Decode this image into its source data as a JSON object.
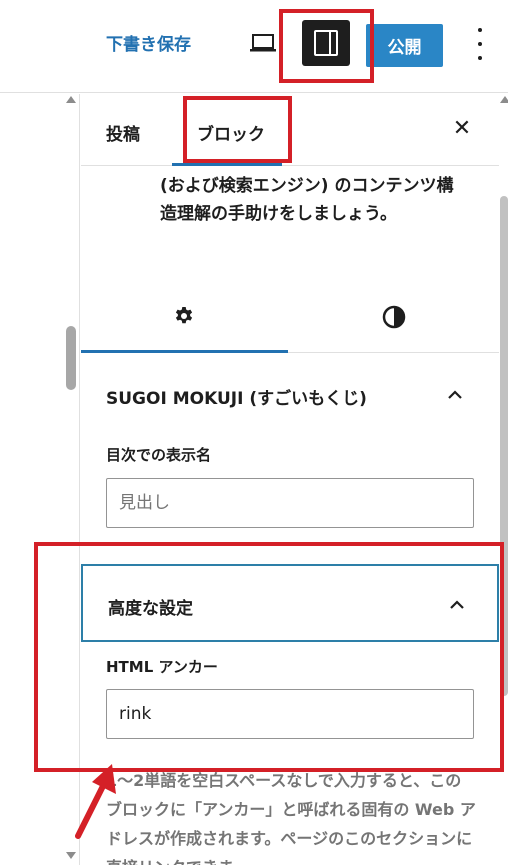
{
  "toolbar": {
    "save_draft_label": "下書き保存",
    "preview_icon": "desktop-preview-icon",
    "sidebar_toggle_icon": "sidebar-toggle-icon",
    "publish_label": "公開",
    "more_icon": "vertical-ellipsis-icon"
  },
  "sidebar": {
    "tab_post_label": "投稿",
    "tab_block_label": "ブロック",
    "close_icon_glyph": "✕",
    "block_description": "(および検索エンジン) のコンテンツ構造理解の手助けをしましょう。",
    "inspector_tabs": {
      "settings_icon": "gear-icon",
      "styles_icon": "half-circle-contrast-icon"
    },
    "toc_panel": {
      "title": "SUGOI MOKUJI (すごいもくじ)",
      "display_name_label": "目次での表示名",
      "display_name_placeholder": "見出し"
    },
    "advanced_panel": {
      "title": "高度な設定",
      "anchor_label": "HTML アンカー",
      "anchor_value": "rink",
      "help_text": "1〜2単語を空白スペースなしで入力すると、このブロックに「アンカー」と呼ばれる固有の Web アドレスが作成されます。ページのこのセクションに直接リンクできま"
    }
  },
  "colors": {
    "accent": "#2271b1",
    "publish_bg": "#2a86c6",
    "annotation": "#d42027",
    "focus_border": "#2d7fa8"
  }
}
